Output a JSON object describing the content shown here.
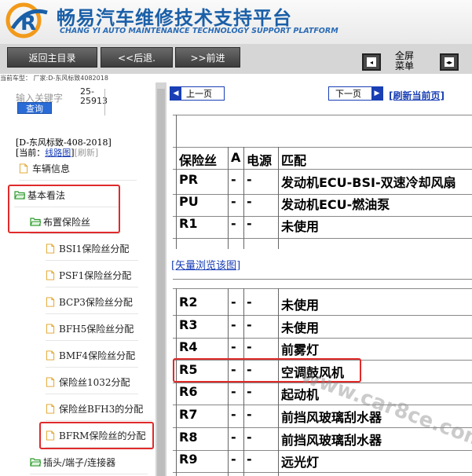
{
  "header": {
    "title": "畅易汽车维修技术支持平台",
    "subtitle": "CHANG YI AUTO MAINTENANCE TECHNOLOGY SUPPORT PLATFORM"
  },
  "toolbar": {
    "back_main": "返回主目录",
    "back": "<<后退.",
    "forward": ">>前进",
    "fullscreen_line1": "全屏",
    "fullscreen_line2": "菜单"
  },
  "carinfo": "当前车型：  厂家:D-东风标致4082018",
  "sidebar": {
    "keyword_placeholder": "输入关键字",
    "keyword_value_line1": "25-",
    "keyword_value_line2": "25913",
    "search_label": "查询",
    "vehicle_line1": "[D-东风标致-408-2018]",
    "current_prefix": "[当前：",
    "current_link": "线路图",
    "current_suffix": "]",
    "refresh": "[刷新]",
    "tree": [
      {
        "label": "车辆信息",
        "icon": "page-icon"
      },
      {
        "label": "基本看法",
        "icon": "folder-open-icon"
      },
      {
        "label": "布置保险丝",
        "icon": "folder-open-icon"
      },
      {
        "label": "BSI1保险丝分配",
        "icon": "page-icon"
      },
      {
        "label": "PSF1保险丝分配",
        "icon": "page-icon"
      },
      {
        "label": "BCP3保险丝分配",
        "icon": "page-icon"
      },
      {
        "label": "BFH5保险丝分配",
        "icon": "page-icon"
      },
      {
        "label": "BMF4保险丝分配",
        "icon": "page-icon"
      },
      {
        "label": "保险丝1032分配",
        "icon": "page-icon"
      },
      {
        "label": "保险丝BFH3的分配",
        "icon": "page-icon"
      },
      {
        "label": "BFRM保险丝的分配",
        "icon": "page-icon"
      },
      {
        "label": "插头/端子/连接器",
        "icon": "folder-open-icon"
      }
    ]
  },
  "content": {
    "prev_page": "上一页",
    "next_page": "下一页",
    "refresh_page": "[刷新当前页]",
    "table1": {
      "headers": [
        "保险丝",
        "A",
        "电源",
        "匹配"
      ],
      "rows": [
        [
          "PR",
          "-",
          "-",
          "发动机ECU-BSI-双速冷却风扇"
        ],
        [
          "PU",
          "-",
          "-",
          "发动机ECU-燃油泵"
        ],
        [
          "R1",
          "-",
          "-",
          "未使用"
        ]
      ]
    },
    "vector_link": "[矢量浏览该图]",
    "table2": {
      "rows": [
        [
          "R2",
          "-",
          "-",
          "未使用"
        ],
        [
          "R3",
          "-",
          "-",
          "未使用"
        ],
        [
          "R4",
          "-",
          "-",
          "前雾灯"
        ],
        [
          "R5",
          "-",
          "-",
          "空调鼓风机"
        ],
        [
          "R6",
          "-",
          "-",
          "起动机"
        ],
        [
          "R7",
          "-",
          "-",
          "前挡风玻璃刮水器"
        ],
        [
          "R8",
          "-",
          "-",
          "前挡风玻璃刮水器"
        ],
        [
          "R9",
          "-",
          "-",
          "远光灯"
        ]
      ]
    },
    "watermark": "www.car8ce.com"
  },
  "colors": {
    "accent": "#1a3fb5",
    "highlight": "#e02a2a",
    "title_blue": "#1a5fa8"
  }
}
